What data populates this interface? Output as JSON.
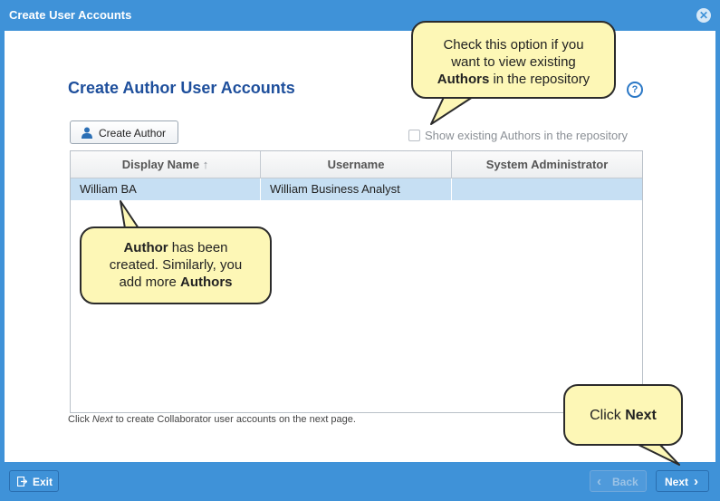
{
  "window": {
    "title": "Create User Accounts"
  },
  "heading": "Create Author User Accounts",
  "toolbar": {
    "create_author_label": "Create Author"
  },
  "show_existing": {
    "label": "Show existing Authors in the repository",
    "checked": false
  },
  "grid": {
    "columns": [
      "Display Name",
      "Username",
      "System Administrator"
    ],
    "sort_indicator": "↑",
    "rows": [
      {
        "display_name": "William BA",
        "username": "William Business Analyst",
        "system_admin": ""
      }
    ]
  },
  "footnote": {
    "prefix": "Click ",
    "emph": "Next",
    "suffix": " to create Collaborator user accounts on the next page."
  },
  "footer": {
    "exit_label": "Exit",
    "back_label": "Back",
    "next_label": "Next"
  },
  "callouts": {
    "top": {
      "line1": "Check this option if you",
      "line2": "want to view existing",
      "bold": "Authors",
      "line3_rest": " in the repository"
    },
    "middle": {
      "bold1": "Author",
      "rest1": " has been",
      "line2": "created. Similarly, you",
      "line3_pre": "add more ",
      "bold2": "Authors"
    },
    "bottom": {
      "pre": "Click ",
      "bold": "Next"
    }
  },
  "colors": {
    "accent": "#3f92d8",
    "heading": "#1e4f9c",
    "selected_row": "#c6dff3",
    "callout_fill": "#fdf7b6"
  }
}
